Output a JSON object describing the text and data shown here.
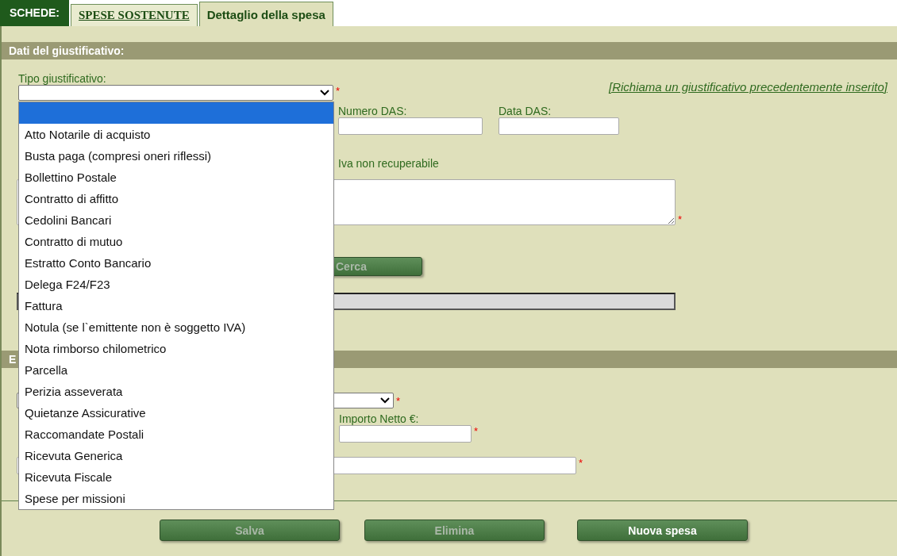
{
  "tabs_label": "SCHEDE:",
  "tabs": [
    {
      "label": "SPESE SOSTENUTE",
      "selected": false
    },
    {
      "label": "Dettaglio della spesa",
      "selected": true
    }
  ],
  "section_1": {
    "title": "Dati del giustificativo:"
  },
  "tipo_giustificativo": {
    "label": "Tipo giustificativo:",
    "asterisk": "*"
  },
  "recall_link": "[Richiama un giustificativo precedentemente inserito]",
  "numero_das": {
    "label": "Numero DAS:"
  },
  "data_das": {
    "label": "Data DAS:"
  },
  "iva_note": "Iva non recuperabile",
  "description": {
    "asterisk": "*"
  },
  "search_button": {
    "label": "Cerca",
    "disabled": true
  },
  "section_2": {
    "title": "E"
  },
  "select_2": {
    "asterisk": "*"
  },
  "importo_netto": {
    "label": "Importo Netto €:",
    "asterisk": "*"
  },
  "field_3": {
    "asterisk": "*"
  },
  "dropdown": {
    "open": true,
    "blank_option_highlighted": true,
    "options": [
      {
        "label": "Atto Notarile di acquisto",
        "selected": false
      },
      {
        "label": "Busta paga (compresi oneri riflessi)",
        "selected": false
      },
      {
        "label": "Bollettino Postale",
        "selected": false
      },
      {
        "label": "Contratto di affitto",
        "selected": false
      },
      {
        "label": "Cedolini Bancari",
        "selected": false
      },
      {
        "label": "Contratto di mutuo",
        "selected": false
      },
      {
        "label": "Estratto Conto Bancario",
        "selected": false
      },
      {
        "label": "Delega F24/F23",
        "selected": false
      },
      {
        "label": "Fattura",
        "selected": false
      },
      {
        "label": "Notula (se l`emittente non è soggetto IVA)",
        "selected": false
      },
      {
        "label": "Nota rimborso chilometrico",
        "selected": false
      },
      {
        "label": "Parcella",
        "selected": false
      },
      {
        "label": "Perizia asseverata",
        "selected": false
      },
      {
        "label": "Quietanze Assicurative",
        "selected": false
      },
      {
        "label": "Raccomandate Postali",
        "selected": false
      },
      {
        "label": "Ricevuta Generica",
        "selected": false
      },
      {
        "label": "Ricevuta Fiscale",
        "selected": false
      },
      {
        "label": "Spese per missioni",
        "selected": false
      }
    ]
  },
  "buttons": [
    {
      "label": "Salva",
      "disabled": true
    },
    {
      "label": "Elimina",
      "disabled": true
    },
    {
      "label": "Nuova spesa",
      "disabled": false
    }
  ]
}
